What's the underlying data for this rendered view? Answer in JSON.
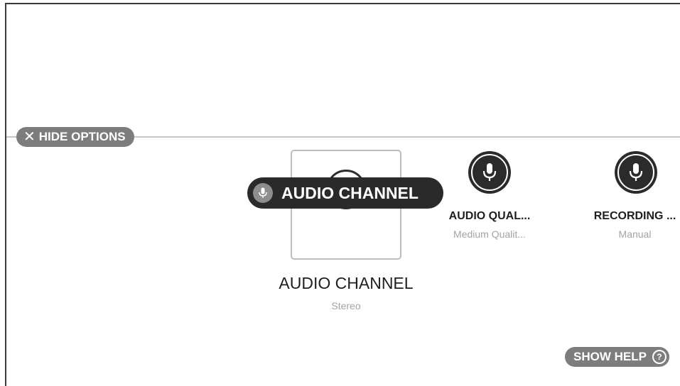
{
  "header": {
    "hide_options_label": "HIDE OPTIONS",
    "close_icon": "close-icon"
  },
  "tooltip": {
    "label": "AUDIO CHANNEL",
    "icon": "microphone-icon"
  },
  "selected_option": {
    "title": "AUDIO CHANNEL",
    "value": "Stereo"
  },
  "options": [
    {
      "title": "AUDIO QUAL...",
      "value": "Medium Qualit...",
      "icon": "microphone-icon"
    },
    {
      "title": "RECORDING ...",
      "value": "Manual",
      "icon": "microphone-icon"
    }
  ],
  "footer": {
    "show_help_label": "SHOW HELP",
    "help_glyph": "?"
  },
  "colors": {
    "pill": "#7d7d7d",
    "icon_dark": "#2b2b2b",
    "subtext": "#a3a3a3",
    "divider": "#c6c6c6"
  }
}
